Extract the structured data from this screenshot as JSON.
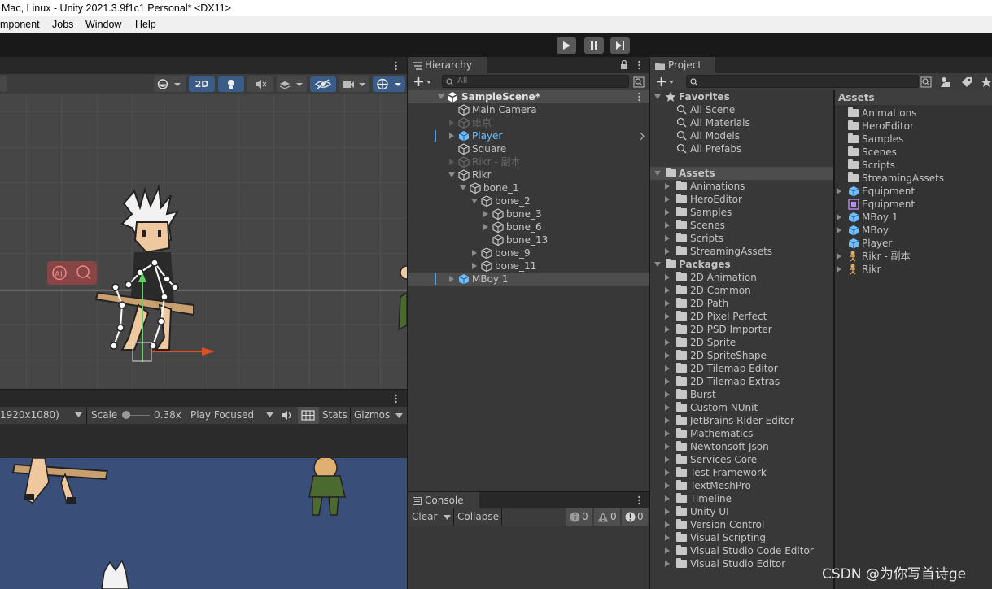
{
  "window": {
    "title": "Mac, Linux - Unity 2021.3.9f1c1 Personal* <DX11>"
  },
  "menu": {
    "component": "mponent",
    "jobs": "Jobs",
    "window": "Window",
    "help": "Help"
  },
  "scene_toolbar": {
    "mode_2d": "2D"
  },
  "game_toolbar": {
    "resolution": "1920x1080)",
    "scale_label": "Scale",
    "scale_value": "0.38x",
    "play_mode": "Play Focused",
    "stats": "Stats",
    "gizmos": "Gizmos"
  },
  "hierarchy": {
    "tab": "Hierarchy",
    "search_placeholder": "All",
    "scene": "SampleScene*",
    "items": {
      "main_camera": "Main Camera",
      "weijing": "维京",
      "player": "Player",
      "square": "Square",
      "rikr_copy": "Rikr - 副本",
      "rikr": "Rikr",
      "bone_1": "bone_1",
      "bone_2": "bone_2",
      "bone_3": "bone_3",
      "bone_6": "bone_6",
      "bone_13": "bone_13",
      "bone_9": "bone_9",
      "bone_11": "bone_11",
      "mboy_1": "MBoy 1"
    }
  },
  "console": {
    "tab": "Console",
    "clear": "Clear",
    "collapse": "Collapse",
    "info_count": "0",
    "warn_count": "0",
    "error_count": "0"
  },
  "project": {
    "tab": "Project",
    "favorites": {
      "label": "Favorites",
      "items": [
        "All Scene",
        "All Materials",
        "All Models",
        "All Prefabs"
      ]
    },
    "assets": {
      "label": "Assets",
      "items": [
        "Animations",
        "HeroEditor",
        "Samples",
        "Scenes",
        "Scripts",
        "StreamingAssets"
      ]
    },
    "packages": {
      "label": "Packages",
      "items": [
        "2D Animation",
        "2D Common",
        "2D Path",
        "2D Pixel Perfect",
        "2D PSD Importer",
        "2D Sprite",
        "2D SpriteShape",
        "2D Tilemap Editor",
        "2D Tilemap Extras",
        "Burst",
        "Custom NUnit",
        "JetBrains Rider Editor",
        "Mathematics",
        "Newtonsoft Json",
        "Services Core",
        "Test Framework",
        "TextMeshPro",
        "Timeline",
        "Unity UI",
        "Version Control",
        "Visual Scripting",
        "Visual Studio Code Editor",
        "Visual Studio Editor"
      ]
    },
    "content": {
      "header": "Assets",
      "folders": [
        "Animations",
        "HeroEditor",
        "Samples",
        "Scenes",
        "Scripts",
        "StreamingAssets"
      ],
      "items": [
        "Equipment",
        "Equipment",
        "MBoy 1",
        "MBoy",
        "Player",
        "Rikr - 副本",
        "Rikr"
      ]
    }
  },
  "watermark": "CSDN @为你写首诗ge",
  "colors": {
    "panel": "#383838",
    "tab": "#3c3c3c",
    "selected": "#4d4d4d",
    "accent": "#4a9ff5",
    "prefab": "#6ebeff",
    "scene_bg": "#464646",
    "game_bg": "#3a4e7a"
  }
}
